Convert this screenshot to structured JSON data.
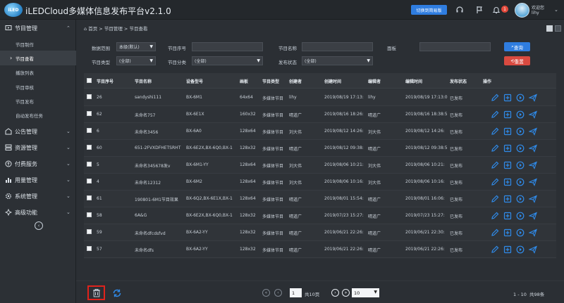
{
  "header": {
    "logo_text": "iLED",
    "app_title": "iLEDCloud多媒体信息发布平台v2.1.0",
    "switch_label": "切换到简易版",
    "notification_count": "1",
    "greeting": "欢迎您",
    "username": "lihy"
  },
  "sidebar": {
    "groups": [
      {
        "label": "节目管理",
        "icon": "program-icon"
      },
      {
        "label": "公告管理",
        "icon": "notice-icon"
      },
      {
        "label": "资源管理",
        "icon": "resource-icon"
      },
      {
        "label": "付费服务",
        "icon": "payment-icon"
      },
      {
        "label": "用量管理",
        "icon": "usage-icon"
      },
      {
        "label": "系统管理",
        "icon": "system-icon"
      },
      {
        "label": "高级功能",
        "icon": "advanced-icon"
      }
    ],
    "sub_items": [
      {
        "label": "节目制作"
      },
      {
        "label": "节目查看"
      },
      {
        "label": "播放列表"
      },
      {
        "label": "节目审核"
      },
      {
        "label": "节目发布"
      },
      {
        "label": "自动发布任务"
      }
    ]
  },
  "breadcrumb": {
    "home": "首页",
    "level1": "节目管理",
    "level2": "节目查看",
    "separator": ">"
  },
  "filters": {
    "scope_label": "数据范围",
    "scope_value": "本级(默认)",
    "program_no_label": "节目序号",
    "program_no_value": "",
    "program_name_label": "节目名称",
    "program_name_value": "",
    "board_label": "面板",
    "board_value": "",
    "program_type_label": "节目类型",
    "program_type_value": "(全部)",
    "program_category_label": "节目分类",
    "program_category_value": "(全部)",
    "publish_status_label": "发布状态",
    "publish_status_value": "(全部)",
    "query_label": "查询",
    "reset_label": "重置"
  },
  "table": {
    "columns": [
      "节目序号",
      "节目名称",
      "设备型号",
      "画板",
      "节目类型",
      "创建者",
      "创建时间",
      "编辑者",
      "编辑时间",
      "发布状态",
      "操作"
    ],
    "rows": [
      {
        "id": "26",
        "name": "sandyshi111",
        "model": "BX-6M1",
        "board": "64x64",
        "type": "多媒体节目",
        "creator": "lihy",
        "created": "2019/08/19 17:13:",
        "editor": "lihy",
        "edited": "2019/08/19 17:13:0",
        "status": "已发布"
      },
      {
        "id": "62",
        "name": "未命名757",
        "model": "BX-6E1X",
        "board": "160x32",
        "type": "多媒体节目",
        "creator": "晴道广",
        "created": "2019/08/16 18:26:",
        "editor": "晴道广",
        "edited": "2019/08/16 18:38:5",
        "status": "已发布"
      },
      {
        "id": "6",
        "name": "未命名3456",
        "model": "BX-6A0",
        "board": "128x64",
        "type": "多媒体节目",
        "creator": "刘大伟",
        "created": "2019/08/12 14:26:",
        "editor": "刘大伟",
        "edited": "2019/08/12 14:26:",
        "status": "已发布"
      },
      {
        "id": "60",
        "name": "651-2FVXDFHETSRHT",
        "model": "BX-6E2X,BX-6Q0,BX-1",
        "board": "128x32",
        "type": "多媒体节目",
        "creator": "晴道广",
        "created": "2019/08/12 09:38:",
        "editor": "晴道广",
        "edited": "2019/08/12 09:38:5",
        "status": "已发布"
      },
      {
        "id": "5",
        "name": "未命名345678发v",
        "model": "BX-6M1-YY",
        "board": "128x64",
        "type": "多媒体节目",
        "creator": "刘大伟",
        "created": "2019/08/06 10:21:",
        "editor": "刘大伟",
        "edited": "2019/08/06 10:21:",
        "status": "已发布"
      },
      {
        "id": "4",
        "name": "未命名12312",
        "model": "BX-6M2",
        "board": "128x64",
        "type": "多媒体节目",
        "creator": "刘大伟",
        "created": "2019/08/06 10:16:",
        "editor": "刘大伟",
        "edited": "2019/08/06 10:16:",
        "status": "已发布"
      },
      {
        "id": "61",
        "name": "190801-6M1节目效果",
        "model": "BX-6Q2,BX-6E1X,BX-1",
        "board": "128x64",
        "type": "多媒体节目",
        "creator": "晴道广",
        "created": "2019/08/01 15:54:",
        "editor": "晴道广",
        "edited": "2019/08/01 16:06:",
        "status": "已发布"
      },
      {
        "id": "58",
        "name": "6A&G",
        "model": "BX-6E2X,BX-6Q0,BX-1",
        "board": "128x32",
        "type": "多媒体节目",
        "creator": "晴道广",
        "created": "2019/07/23 15:27:",
        "editor": "晴道广",
        "edited": "2019/07/23 15:27:",
        "status": "已发布"
      },
      {
        "id": "59",
        "name": "未命名dfcdsfvd",
        "model": "BX-6A2-YY",
        "board": "128x32",
        "type": "多媒体节目",
        "creator": "晴道广",
        "created": "2019/06/21 22:26:",
        "editor": "晴道广",
        "edited": "2019/06/21 22:30:",
        "status": "已发布"
      },
      {
        "id": "57",
        "name": "未命名dfs",
        "model": "BX-6A2-YY",
        "board": "128x32",
        "type": "多媒体节目",
        "creator": "晴道广",
        "created": "2019/06/21 22:26:",
        "editor": "晴道广",
        "edited": "2019/06/21 22:26:",
        "status": "已发布"
      }
    ]
  },
  "pagination": {
    "current_page": "1",
    "total_pages": "共10页",
    "page_size": "10",
    "range": "1 - 10",
    "total_count": "共98条"
  },
  "colors": {
    "accent_blue": "#2f7de0",
    "reset_red": "#d94a40",
    "highlight_red": "#e0231c",
    "action_icon": "#2f8bea"
  }
}
